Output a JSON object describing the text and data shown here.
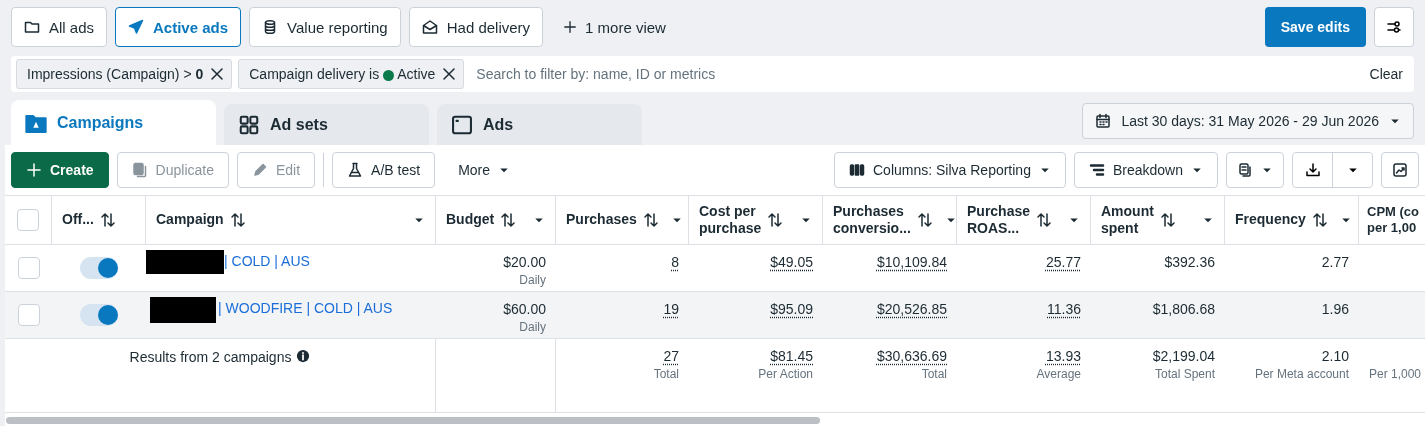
{
  "views": [
    {
      "label": "All ads",
      "selected": false
    },
    {
      "label": "Active ads",
      "selected": true
    },
    {
      "label": "Value reporting",
      "selected": false
    },
    {
      "label": "Had delivery",
      "selected": false
    }
  ],
  "more_views": "1 more view",
  "save_button": "Save edits",
  "filters": [
    {
      "text": "Impressions (Campaign) > ",
      "value": "0",
      "kind": "bold"
    },
    {
      "text": "Campaign delivery is",
      "value": "Active",
      "kind": "status",
      "color": "#0a7a4a"
    }
  ],
  "search": {
    "placeholder": "Search to filter by: name, ID or metrics"
  },
  "clear": "Clear",
  "tabs": [
    {
      "label": "Campaigns",
      "selected": true
    },
    {
      "label": "Ad sets",
      "selected": false
    },
    {
      "label": "Ads",
      "selected": false
    }
  ],
  "date_range": "Last 30 days: 31 May 2026 - 29 Jun 2026",
  "toolbar": [
    {
      "label": "Create",
      "kind": "primary",
      "disabled": false
    },
    {
      "label": "Duplicate",
      "kind": "duplicate",
      "disabled": true
    },
    {
      "label": "Edit",
      "kind": "edit",
      "disabled": true
    },
    {
      "label": "A/B test",
      "kind": "test",
      "disabled": false
    },
    {
      "label": "More",
      "kind": "menu",
      "disabled": false
    }
  ],
  "columns_button": "Columns: Silva Reporting",
  "breakdown_button": "Breakdown",
  "table": {
    "select_all": {
      "checked": false
    },
    "columns": [
      {
        "label": "Off...",
        "sortable": true,
        "menu": false
      },
      {
        "label": "Campaign",
        "sortable": true,
        "menu": true
      },
      {
        "label": "Budget",
        "sortable": true,
        "menu": true
      },
      {
        "label": "Purchases",
        "sortable": true,
        "menu": true,
        "dotted": true
      },
      {
        "label": "Cost per\npurchase",
        "sortable": true,
        "menu": true,
        "dotted": true
      },
      {
        "label": "Purchases\nconversio...",
        "sortable": true,
        "menu": true,
        "dotted": true
      },
      {
        "label": "Purchase\nROAS...",
        "sortable": true,
        "menu": true,
        "dotted": true
      },
      {
        "label": "Amount\nspent",
        "sortable": true,
        "menu": true,
        "dotted": false
      },
      {
        "label": "Frequency",
        "sortable": true,
        "menu": true,
        "dotted": false
      },
      {
        "label": "CPM (co\nper 1,00",
        "sortable": false,
        "menu": false,
        "dotted": false
      }
    ],
    "rows": [
      {
        "checked": false,
        "on": true,
        "redacted": true,
        "name": "| COLD | AUS",
        "hovered": false,
        "budget": {
          "value": "$20.00",
          "sub": "Daily"
        },
        "metrics": [
          "8",
          "$49.05",
          "$10,109.84",
          "25.77",
          "$392.36",
          "2.77"
        ]
      },
      {
        "checked": false,
        "on": true,
        "redacted": true,
        "name": "| WOODFIRE | COLD | AUS",
        "hovered": true,
        "budget": {
          "value": "$60.00",
          "sub": "Daily"
        },
        "metrics": [
          "19",
          "$95.09",
          "$20,526.85",
          "11.36",
          "$1,806.68",
          "1.96"
        ]
      }
    ],
    "summary": {
      "label": "Results from 2 campaigns",
      "totals": [
        {
          "value": "27",
          "sub": "Total"
        },
        {
          "value": "$81.45",
          "sub": "Per Action"
        },
        {
          "value": "$30,636.69",
          "sub": "Total"
        },
        {
          "value": "13.93",
          "sub": "Average"
        },
        {
          "value": "$2,199.04",
          "sub": "Total Spent"
        },
        {
          "value": "2.10",
          "sub": "Per Meta account"
        },
        {
          "sub": "Per 1,000"
        }
      ]
    }
  }
}
